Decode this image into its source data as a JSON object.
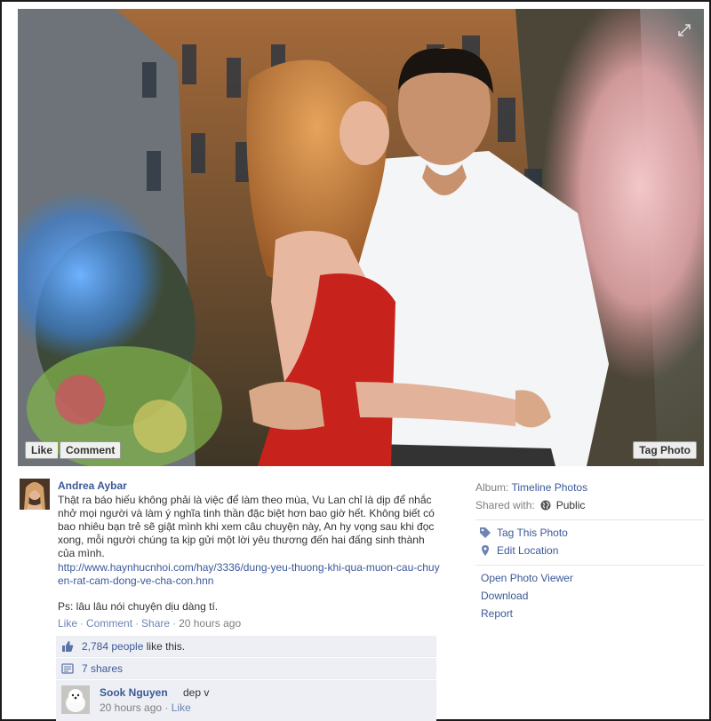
{
  "photo": {
    "like_label": "Like",
    "comment_label": "Comment",
    "tag_label": "Tag Photo",
    "expand_icon": "expand-icon"
  },
  "post": {
    "author": "Andrea Aybar",
    "caption": "Thật ra báo hiếu không phải là việc để làm theo mùa, Vu Lan chỉ là dịp để nhắc nhở mọi người và làm ý nghĩa tinh thần đặc biệt hơn bao giờ hết. Không biết có bao nhiêu bạn trẻ sẽ giật mình khi xem câu chuyện này, An hy vọng sau khi đọc xong, mỗi người chúng ta kịp gửi một lời yêu thương đến hai đấng sinh thành của mình.",
    "link": "http://www.haynhucnhoi.com/hay/3336/dung-yeu-thuong-khi-qua-muon-cau-chuyen-rat-cam-dong-ve-cha-con.hnn",
    "ps": "Ps: lâu lâu nói chuyện dịu dàng tí.",
    "actions": {
      "like": "Like",
      "comment": "Comment",
      "share": "Share",
      "time": "20 hours ago"
    }
  },
  "ufi": {
    "likes_count": "2,784 people",
    "likes_suffix": "like this.",
    "shares": "7 shares",
    "comments": [
      {
        "name": "Sook Nguyen",
        "text": "dep v",
        "time": "20 hours ago",
        "like": "Like"
      }
    ]
  },
  "sidebar": {
    "album_label": "Album:",
    "album_value": "Timeline Photos",
    "shared_label": "Shared with:",
    "shared_value": "Public",
    "tag_this_photo": "Tag This Photo",
    "edit_location": "Edit Location",
    "open_viewer": "Open Photo Viewer",
    "download": "Download",
    "report": "Report"
  },
  "colors": {
    "link": "#3b5998",
    "ufi_bg": "#edeff4",
    "muted": "#7f7f7f"
  }
}
